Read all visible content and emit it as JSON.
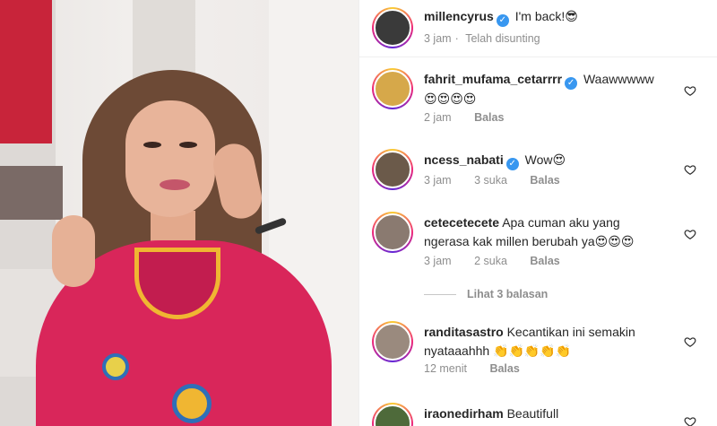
{
  "post": {
    "caption": {
      "username": "millencyrus",
      "text": "I'm back!😎",
      "time": "3 jam",
      "edited": "Telah disunting"
    }
  },
  "comments": [
    {
      "username": "fahrit_mufama_cetarrrr",
      "verified": true,
      "text": "Waawwwww",
      "text2": "😍😍😍😍",
      "time": "2 jam",
      "likes": "",
      "reply": "Balas"
    },
    {
      "username": "ncess_nabati",
      "verified": true,
      "text": "Wow😍",
      "time": "3 jam",
      "likes": "3 suka",
      "reply": "Balas"
    },
    {
      "username": "cetecetecete",
      "verified": false,
      "text": "Apa cuman aku yang",
      "text2": "ngerasa kak millen berubah ya😍😍😍",
      "time": "3 jam",
      "likes": "2 suka",
      "reply": "Balas"
    },
    {
      "username": "randitasastro",
      "verified": false,
      "text": "Kecantikan ini semakin",
      "text2": "nyataaahhh 👏👏👏👏👏",
      "time": "12 menit",
      "likes": "",
      "reply": "Balas"
    },
    {
      "username": "iraonedirham",
      "verified": false,
      "text": "Beautifull",
      "time": "",
      "likes": "",
      "reply": ""
    }
  ],
  "view_replies": "Lihat 3 balasan",
  "icons": {
    "verified": "verified-badge-icon",
    "like": "heart-icon"
  },
  "colors": {
    "verified": "#3897f0",
    "muted": "#8e8e8e",
    "dress": "#d9265a"
  }
}
